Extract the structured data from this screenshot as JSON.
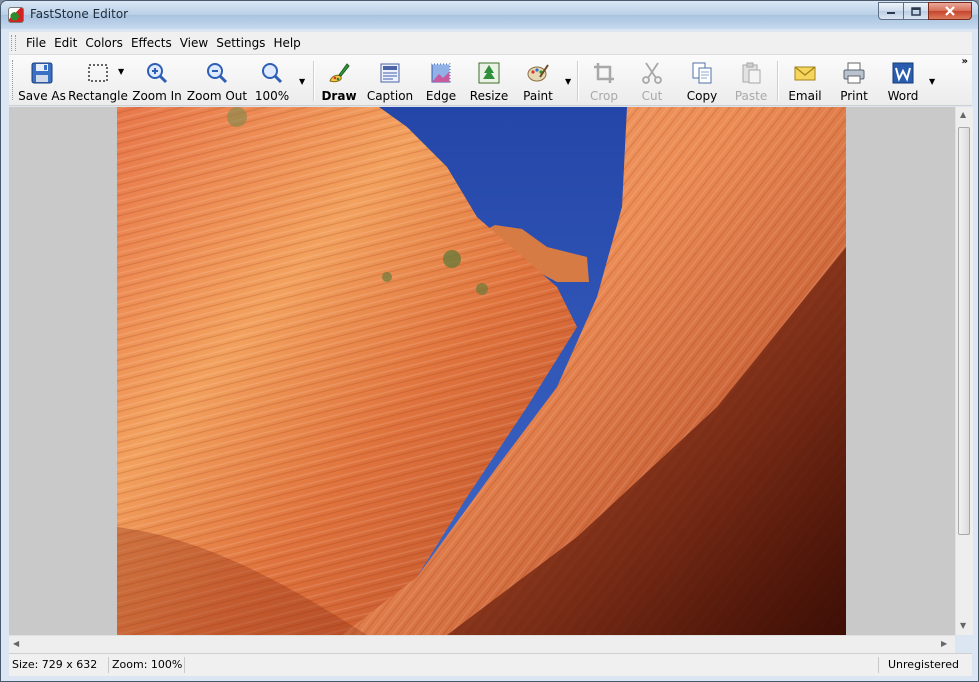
{
  "window": {
    "title": "FastStone Editor"
  },
  "menu": [
    "File",
    "Edit",
    "Colors",
    "Effects",
    "View",
    "Settings",
    "Help"
  ],
  "toolbar": {
    "save_as": "Save As",
    "rectangle": "Rectangle",
    "zoom_in": "Zoom In",
    "zoom_out": "Zoom Out",
    "zoom_level": "100%",
    "draw": "Draw",
    "caption": "Caption",
    "edge": "Edge",
    "resize": "Resize",
    "paint": "Paint",
    "crop": "Crop",
    "cut": "Cut",
    "copy": "Copy",
    "paste": "Paste",
    "email": "Email",
    "print": "Print",
    "word": "Word",
    "more": "»"
  },
  "status": {
    "size": "Size: 729 x 632",
    "zoom": "Zoom: 100%",
    "registration": "Unregistered"
  },
  "colors": {
    "sky": "#2f57b8",
    "rock_light": "#f0a060",
    "rock_dark": "#c2451f"
  },
  "icons": [
    "app-icon",
    "minimize-icon",
    "maximize-icon",
    "close-icon",
    "save-icon",
    "rectangle-select-icon",
    "zoom-in-icon",
    "zoom-out-icon",
    "zoom-icon",
    "draw-icon",
    "caption-icon",
    "edge-icon",
    "resize-icon",
    "paint-icon",
    "crop-icon",
    "cut-icon",
    "copy-icon",
    "paste-icon",
    "email-icon",
    "print-icon",
    "word-icon"
  ]
}
